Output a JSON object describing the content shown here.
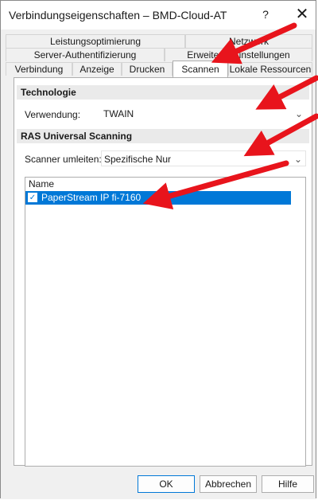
{
  "window": {
    "title": "Verbindungseigenschaften – BMD-Cloud-AT",
    "help_label": "?",
    "close_label": "✕"
  },
  "tabs": {
    "row1": [
      "Leistungsoptimierung",
      "Netzwerk"
    ],
    "row2": [
      "Server-Authentifizierung",
      "Erweiterte Einstellungen"
    ],
    "row3": [
      "Verbindung",
      "Anzeige",
      "Drucken",
      "Scannen",
      "Lokale Ressourcen"
    ],
    "active": "Scannen"
  },
  "technologie": {
    "header": "Technologie",
    "verwendung_label": "Verwendung:",
    "verwendung_value": "TWAIN"
  },
  "ras": {
    "header": "RAS Universal Scanning",
    "umleiten_label": "Scanner umleiten:",
    "umleiten_value": "Spezifische Nur"
  },
  "scanner_list": {
    "column_header": "Name",
    "items": [
      {
        "name": "PaperStream IP fi-7160",
        "checked": true
      }
    ]
  },
  "buttons": {
    "ok": "OK",
    "cancel": "Abbrechen",
    "help": "Hilfe"
  },
  "annotation_color": "#e8141c"
}
